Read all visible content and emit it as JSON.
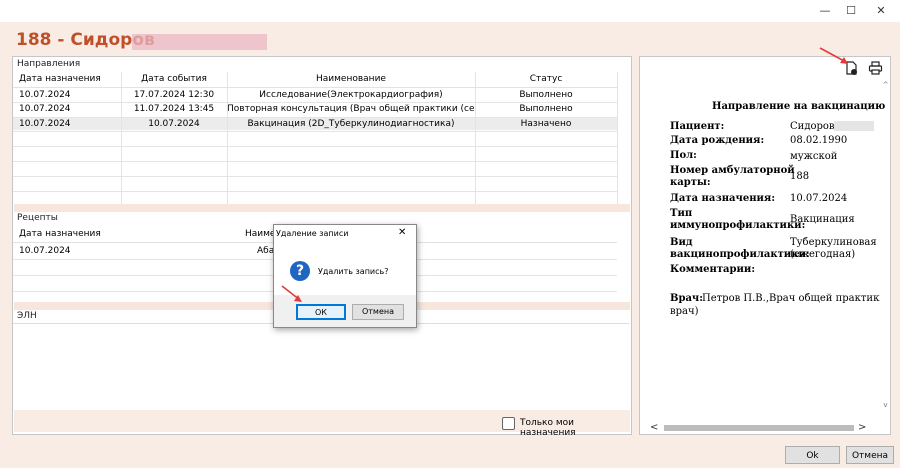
{
  "window": {
    "controls": [
      "—",
      "☐",
      "✕"
    ]
  },
  "header": {
    "title": "188 - Сидоров"
  },
  "directions": {
    "section_label": "Направления",
    "columns": [
      "Дата назначения",
      "Дата события",
      "Наименование",
      "Статус"
    ],
    "rows": [
      [
        "10.07.2024",
        "17.07.2024 12:30",
        "Исследование(Электрокардиография)",
        "Выполнено"
      ],
      [
        "10.07.2024",
        "11.07.2024 13:45",
        "Повторная консультация (Врач общей практики (семей…",
        "Выполнено"
      ],
      [
        "10.07.2024",
        "10.07.2024",
        "Вакцинация (2D_Туберкулинодиагностика)",
        "Назначено"
      ]
    ]
  },
  "recipes": {
    "section_label": "Рецепты",
    "columns": [
      "Дата назначения",
      "Наиме"
    ],
    "rows": [
      [
        "10.07.2024",
        "Аба"
      ]
    ]
  },
  "eln": {
    "section_label": "ЭЛН"
  },
  "only_mine": {
    "label": "Только мои назначения"
  },
  "document": {
    "title": "Направление на вакцинацию",
    "fields": [
      {
        "label": "Пациент:",
        "value": "Сидоров"
      },
      {
        "label": "Дата рождения:",
        "value": "08.02.1990"
      },
      {
        "label": "Пол:",
        "value": "мужской"
      },
      {
        "label": "Номер амбулаторной",
        "label2": "карты:",
        "value": "188"
      },
      {
        "label": "Дата назначения:",
        "value": "10.07.2024"
      },
      {
        "label": "Тип",
        "label2": "иммунопрофилактики:",
        "value": "Вакцинация"
      },
      {
        "label": "Вид",
        "label2": "вакцинопрофилактики:",
        "value": "Туберкулиновая п",
        "value2": "(ежегодная)"
      },
      {
        "label": "Комментарии:",
        "value": ""
      }
    ],
    "doctor_label": "Врач:",
    "doctor_value": "Петров П.В.,Врач общей практики (се",
    "doctor_value2": "врач)"
  },
  "dialog": {
    "title": "Удаление записи",
    "message": "Удалить запись?",
    "ok_label": "ОК",
    "cancel_label": "Отмена",
    "close": "✕"
  },
  "footer": {
    "ok_label": "Ok",
    "cancel_label": "Отмена"
  },
  "scroll": {
    "left": "<",
    "right": ">",
    "up": "^",
    "down": "v"
  },
  "colors": {
    "accent": "#c0502a",
    "arrow": "#e23b3b",
    "dialog_icon": "#1f66c4"
  }
}
